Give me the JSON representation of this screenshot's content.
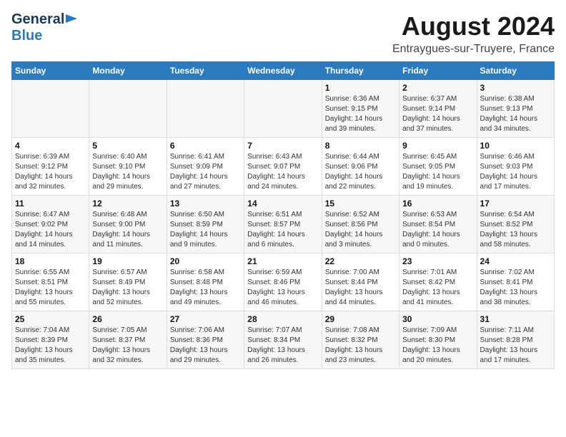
{
  "header": {
    "logo_line1": "General",
    "logo_line2": "Blue",
    "month_year": "August 2024",
    "location": "Entraygues-sur-Truyere, France"
  },
  "days_of_week": [
    "Sunday",
    "Monday",
    "Tuesday",
    "Wednesday",
    "Thursday",
    "Friday",
    "Saturday"
  ],
  "weeks": [
    [
      {
        "day": "",
        "info": ""
      },
      {
        "day": "",
        "info": ""
      },
      {
        "day": "",
        "info": ""
      },
      {
        "day": "",
        "info": ""
      },
      {
        "day": "1",
        "info": "Sunrise: 6:36 AM\nSunset: 9:15 PM\nDaylight: 14 hours\nand 39 minutes."
      },
      {
        "day": "2",
        "info": "Sunrise: 6:37 AM\nSunset: 9:14 PM\nDaylight: 14 hours\nand 37 minutes."
      },
      {
        "day": "3",
        "info": "Sunrise: 6:38 AM\nSunset: 9:13 PM\nDaylight: 14 hours\nand 34 minutes."
      }
    ],
    [
      {
        "day": "4",
        "info": "Sunrise: 6:39 AM\nSunset: 9:12 PM\nDaylight: 14 hours\nand 32 minutes."
      },
      {
        "day": "5",
        "info": "Sunrise: 6:40 AM\nSunset: 9:10 PM\nDaylight: 14 hours\nand 29 minutes."
      },
      {
        "day": "6",
        "info": "Sunrise: 6:41 AM\nSunset: 9:09 PM\nDaylight: 14 hours\nand 27 minutes."
      },
      {
        "day": "7",
        "info": "Sunrise: 6:43 AM\nSunset: 9:07 PM\nDaylight: 14 hours\nand 24 minutes."
      },
      {
        "day": "8",
        "info": "Sunrise: 6:44 AM\nSunset: 9:06 PM\nDaylight: 14 hours\nand 22 minutes."
      },
      {
        "day": "9",
        "info": "Sunrise: 6:45 AM\nSunset: 9:05 PM\nDaylight: 14 hours\nand 19 minutes."
      },
      {
        "day": "10",
        "info": "Sunrise: 6:46 AM\nSunset: 9:03 PM\nDaylight: 14 hours\nand 17 minutes."
      }
    ],
    [
      {
        "day": "11",
        "info": "Sunrise: 6:47 AM\nSunset: 9:02 PM\nDaylight: 14 hours\nand 14 minutes."
      },
      {
        "day": "12",
        "info": "Sunrise: 6:48 AM\nSunset: 9:00 PM\nDaylight: 14 hours\nand 11 minutes."
      },
      {
        "day": "13",
        "info": "Sunrise: 6:50 AM\nSunset: 8:59 PM\nDaylight: 14 hours\nand 9 minutes."
      },
      {
        "day": "14",
        "info": "Sunrise: 6:51 AM\nSunset: 8:57 PM\nDaylight: 14 hours\nand 6 minutes."
      },
      {
        "day": "15",
        "info": "Sunrise: 6:52 AM\nSunset: 8:56 PM\nDaylight: 14 hours\nand 3 minutes."
      },
      {
        "day": "16",
        "info": "Sunrise: 6:53 AM\nSunset: 8:54 PM\nDaylight: 14 hours\nand 0 minutes."
      },
      {
        "day": "17",
        "info": "Sunrise: 6:54 AM\nSunset: 8:52 PM\nDaylight: 13 hours\nand 58 minutes."
      }
    ],
    [
      {
        "day": "18",
        "info": "Sunrise: 6:55 AM\nSunset: 8:51 PM\nDaylight: 13 hours\nand 55 minutes."
      },
      {
        "day": "19",
        "info": "Sunrise: 6:57 AM\nSunset: 8:49 PM\nDaylight: 13 hours\nand 52 minutes."
      },
      {
        "day": "20",
        "info": "Sunrise: 6:58 AM\nSunset: 8:48 PM\nDaylight: 13 hours\nand 49 minutes."
      },
      {
        "day": "21",
        "info": "Sunrise: 6:59 AM\nSunset: 8:46 PM\nDaylight: 13 hours\nand 46 minutes."
      },
      {
        "day": "22",
        "info": "Sunrise: 7:00 AM\nSunset: 8:44 PM\nDaylight: 13 hours\nand 44 minutes."
      },
      {
        "day": "23",
        "info": "Sunrise: 7:01 AM\nSunset: 8:42 PM\nDaylight: 13 hours\nand 41 minutes."
      },
      {
        "day": "24",
        "info": "Sunrise: 7:02 AM\nSunset: 8:41 PM\nDaylight: 13 hours\nand 38 minutes."
      }
    ],
    [
      {
        "day": "25",
        "info": "Sunrise: 7:04 AM\nSunset: 8:39 PM\nDaylight: 13 hours\nand 35 minutes."
      },
      {
        "day": "26",
        "info": "Sunrise: 7:05 AM\nSunset: 8:37 PM\nDaylight: 13 hours\nand 32 minutes."
      },
      {
        "day": "27",
        "info": "Sunrise: 7:06 AM\nSunset: 8:36 PM\nDaylight: 13 hours\nand 29 minutes."
      },
      {
        "day": "28",
        "info": "Sunrise: 7:07 AM\nSunset: 8:34 PM\nDaylight: 13 hours\nand 26 minutes."
      },
      {
        "day": "29",
        "info": "Sunrise: 7:08 AM\nSunset: 8:32 PM\nDaylight: 13 hours\nand 23 minutes."
      },
      {
        "day": "30",
        "info": "Sunrise: 7:09 AM\nSunset: 8:30 PM\nDaylight: 13 hours\nand 20 minutes."
      },
      {
        "day": "31",
        "info": "Sunrise: 7:11 AM\nSunset: 8:28 PM\nDaylight: 13 hours\nand 17 minutes."
      }
    ]
  ]
}
